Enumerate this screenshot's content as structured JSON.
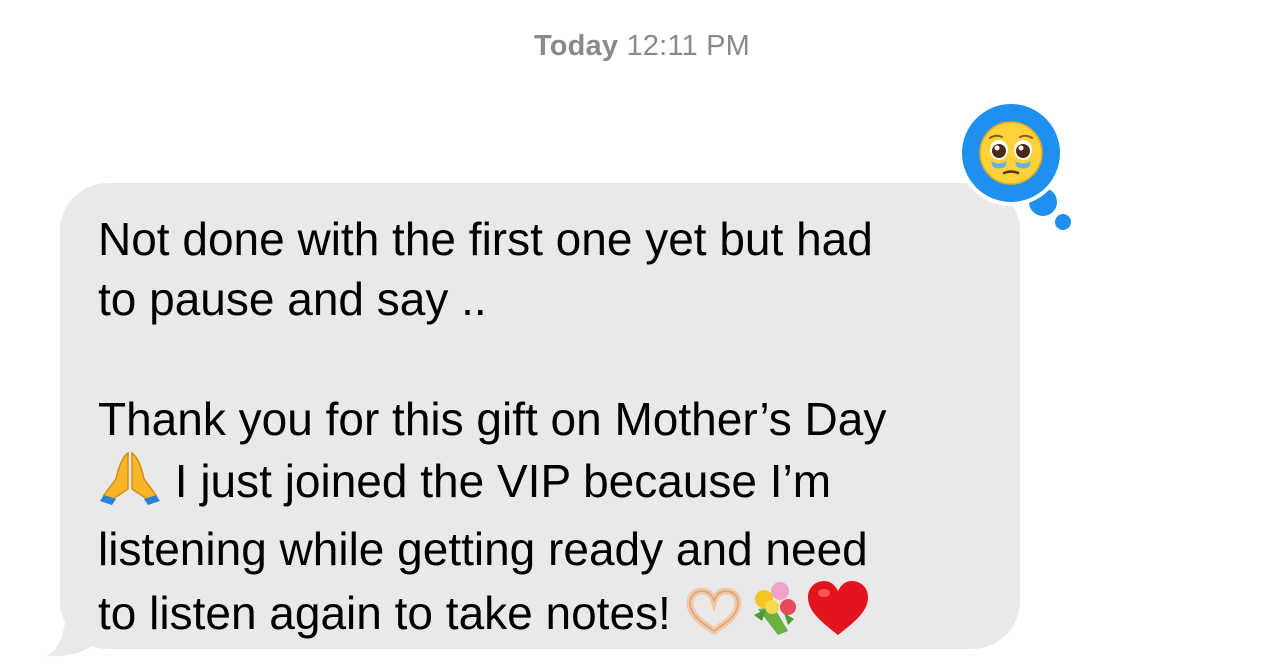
{
  "timestamp": {
    "day": "Today",
    "time": "12:11 PM"
  },
  "message": {
    "line1": "Not done with the first one yet but had",
    "line2": "to pause and say ..",
    "line3": "Thank you for this gift on Mother’s Day",
    "line4_after_emoji": " I just joined the VIP because I’m",
    "line5": "listening while getting ready and need",
    "line6_before_emoji": "to listen again to take notes! ",
    "emojis": [
      "folded-hands-icon",
      "heart-hands-icon",
      "bouquet-icon",
      "red-heart-icon"
    ]
  },
  "tapback": {
    "icon": "pleading-face-icon",
    "color": "#1f8ff0"
  },
  "colors": {
    "bubble": "#e9e9eb",
    "timestamp": "#8a8a8e",
    "tapback": "#1f8ff0"
  }
}
